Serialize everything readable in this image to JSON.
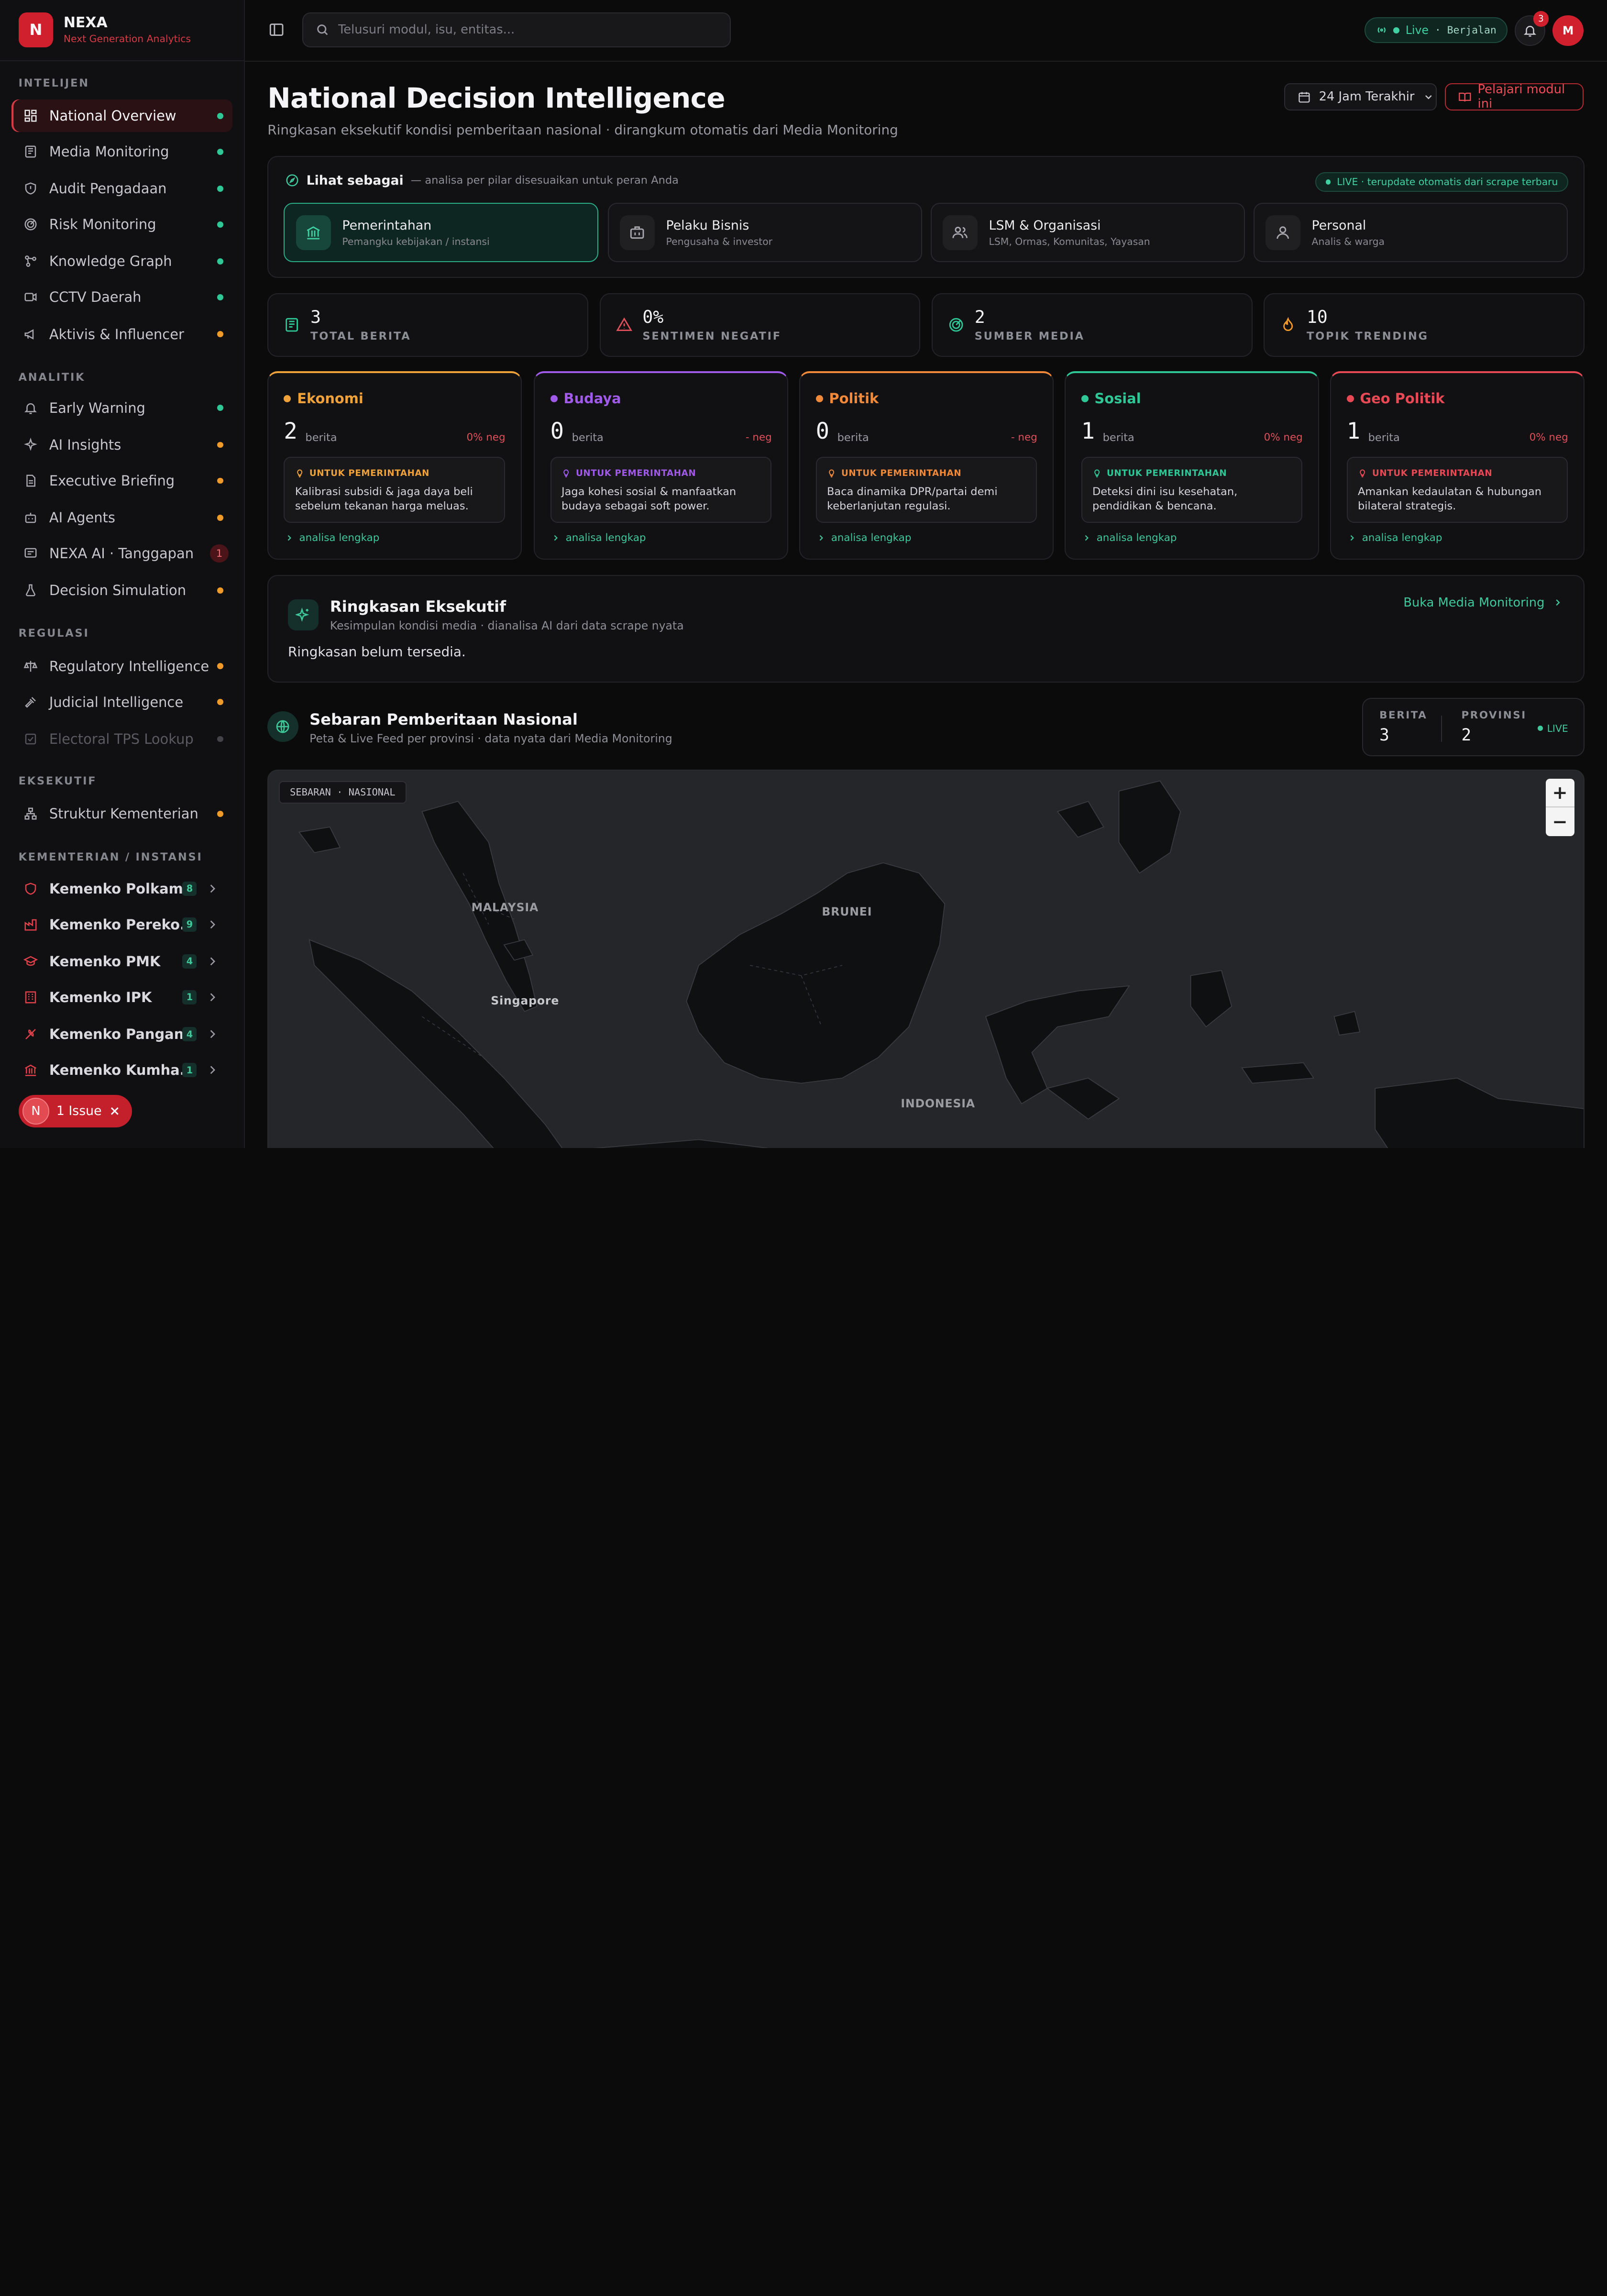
{
  "brand": {
    "logo": "N",
    "title": "NEXA",
    "subtitle": "Next Generation Analytics"
  },
  "colors": {
    "accent": "#d0202d",
    "live": "#2fc796",
    "warn": "#f09a2a"
  },
  "sidebar": {
    "sections": {
      "intelijen": "INTELIJEN",
      "analitik": "ANALITIK",
      "regulasi": "REGULASI",
      "eksekutif": "EKSEKUTIF",
      "kementerian": "KEMENTERIAN / INSTANSI"
    },
    "intelijen": [
      {
        "label": "National Overview",
        "icon": "dashboard-icon",
        "status": "green"
      },
      {
        "label": "Media Monitoring",
        "icon": "newspaper-icon",
        "status": "green"
      },
      {
        "label": "Audit Pengadaan",
        "icon": "shield-icon",
        "status": "green"
      },
      {
        "label": "Risk Monitoring",
        "icon": "radar-icon",
        "status": "green"
      },
      {
        "label": "Knowledge Graph",
        "icon": "graph-icon",
        "status": "green"
      },
      {
        "label": "CCTV Daerah",
        "icon": "video-icon",
        "status": "green"
      },
      {
        "label": "Aktivis & Influencer",
        "icon": "megaphone-icon",
        "status": "orange"
      }
    ],
    "analitik": [
      {
        "label": "Early Warning",
        "icon": "bell-ring-icon",
        "status": "green"
      },
      {
        "label": "AI Insights",
        "icon": "sparkles-icon",
        "status": "orange"
      },
      {
        "label": "Executive Briefing",
        "icon": "document-icon",
        "status": "orange"
      },
      {
        "label": "AI Agents",
        "icon": "bot-icon",
        "status": "orange"
      },
      {
        "label": "NEXA AI · Tanggapan",
        "icon": "chat-icon",
        "badge": "1"
      },
      {
        "label": "Decision Simulation",
        "icon": "flask-icon",
        "status": "orange"
      }
    ],
    "regulasi": [
      {
        "label": "Regulatory Intelligence",
        "icon": "scale-icon",
        "status": "orange"
      },
      {
        "label": "Judicial Intelligence",
        "icon": "gavel-icon",
        "status": "orange"
      },
      {
        "label": "Electoral TPS Lookup",
        "icon": "ballot-icon",
        "status": "gray"
      }
    ],
    "eksekutif": [
      {
        "label": "Struktur Kementerian",
        "icon": "org-chart-icon",
        "status": "orange"
      }
    ],
    "kementerian": [
      {
        "label": "Kemenko Polkam",
        "icon": "shield-icon",
        "count": "8"
      },
      {
        "label": "Kemenko Pereko...",
        "icon": "factory-icon",
        "count": "9"
      },
      {
        "label": "Kemenko PMK",
        "icon": "graduation-cap-icon",
        "count": "4"
      },
      {
        "label": "Kemenko IPK",
        "icon": "building-icon",
        "count": "1"
      },
      {
        "label": "Kemenko Pangan",
        "icon": "wheat-icon",
        "count": "4"
      },
      {
        "label": "Kemenko Kumha...",
        "icon": "landmark-icon",
        "count": "1"
      }
    ],
    "issue": {
      "logo": "N",
      "label": "1 Issue"
    }
  },
  "topbar": {
    "search_placeholder": "Telusuri modul, isu, entitas...",
    "live_label": "Live",
    "live_status": "· Berjalan",
    "notif_count": "3",
    "avatar": "M"
  },
  "header": {
    "title": "National Decision Intelligence",
    "subtitle": "Ringkasan eksekutif kondisi pemberitaan nasional · dirangkum otomatis dari Media Monitoring",
    "time_range": "24 Jam Terakhir",
    "learn_label": "Pelajari modul ini"
  },
  "persona": {
    "title": "Lihat sebagai",
    "note": "— analisa per pilar disesuaikan untuk peran Anda",
    "live_tag": "LIVE · terupdate otomatis dari scrape terbaru",
    "options": [
      {
        "title": "Pemerintahan",
        "sub": "Pemangku kebijakan / instansi",
        "icon": "landmark-icon",
        "active": true
      },
      {
        "title": "Pelaku Bisnis",
        "sub": "Pengusaha & investor",
        "icon": "briefcase-icon"
      },
      {
        "title": "LSM & Organisasi",
        "sub": "LSM, Ormas, Komunitas, Yayasan",
        "icon": "users-icon"
      },
      {
        "title": "Personal",
        "sub": "Analis & warga",
        "icon": "user-icon"
      }
    ]
  },
  "stats": [
    {
      "value": "3",
      "label": "TOTAL BERITA",
      "icon": "newspaper-icon",
      "color": "#2fc796"
    },
    {
      "value": "0%",
      "label": "SENTIMEN NEGATIF",
      "icon": "alert-triangle-icon",
      "color": "#e0505a"
    },
    {
      "value": "2",
      "label": "SUMBER MEDIA",
      "icon": "radar-icon",
      "color": "#2fc796"
    },
    {
      "value": "10",
      "label": "TOPIK TRENDING",
      "icon": "flame-icon",
      "color": "#f09a2a"
    }
  ],
  "pillars": [
    {
      "name": "Ekonomi",
      "color": "#f0a23a",
      "count": "2",
      "berita": "berita",
      "neg": "0% neg",
      "tag": "UNTUK PEMERINTAHAN",
      "text": "Kalibrasi subsidi & jaga daya beli sebelum tekanan harga meluas.",
      "link": "analisa lengkap"
    },
    {
      "name": "Budaya",
      "color": "#a05ae8",
      "count": "0",
      "berita": "berita",
      "neg": "- neg",
      "tag": "UNTUK PEMERINTAHAN",
      "text": "Jaga kohesi sosial & manfaatkan budaya sebagai soft power.",
      "link": "analisa lengkap"
    },
    {
      "name": "Politik",
      "color": "#f08a3a",
      "count": "0",
      "berita": "berita",
      "neg": "- neg",
      "tag": "UNTUK PEMERINTAHAN",
      "text": "Baca dinamika DPR/partai demi keberlanjutan regulasi.",
      "link": "analisa lengkap"
    },
    {
      "name": "Sosial",
      "color": "#2fc796",
      "count": "1",
      "berita": "berita",
      "neg": "0% neg",
      "tag": "UNTUK PEMERINTAHAN",
      "text": "Deteksi dini isu kesehatan, pendidikan & bencana.",
      "link": "analisa lengkap"
    },
    {
      "name": "Geo Politik",
      "color": "#e84a55",
      "count": "1",
      "berita": "berita",
      "neg": "0% neg",
      "tag": "UNTUK PEMERINTAHAN",
      "text": "Amankan kedaulatan & hubungan bilateral strategis.",
      "link": "analisa lengkap"
    }
  ],
  "executive": {
    "title": "Ringkasan Eksekutif",
    "subtitle": "Kesimpulan kondisi media · dianalisa AI dari data scrape nyata",
    "link": "Buka Media Monitoring",
    "body": "Ringkasan belum tersedia."
  },
  "geo": {
    "title": "Sebaran Pemberitaan Nasional",
    "subtitle": "Peta & Live Feed per provinsi · data nyata dari Media Monitoring",
    "berita_label": "BERITA",
    "berita_value": "3",
    "provinsi_label": "PROVINSI",
    "provinsi_value": "2",
    "live": "LIVE"
  },
  "map": {
    "tag": "SEBARAN · NASIONAL",
    "zoom_in": "+",
    "zoom_out": "−",
    "labels": {
      "malaysia": "MALAYSIA",
      "brunei": "BRUNEI",
      "singapore": "Singapore",
      "indonesia": "INDONESIA"
    }
  }
}
